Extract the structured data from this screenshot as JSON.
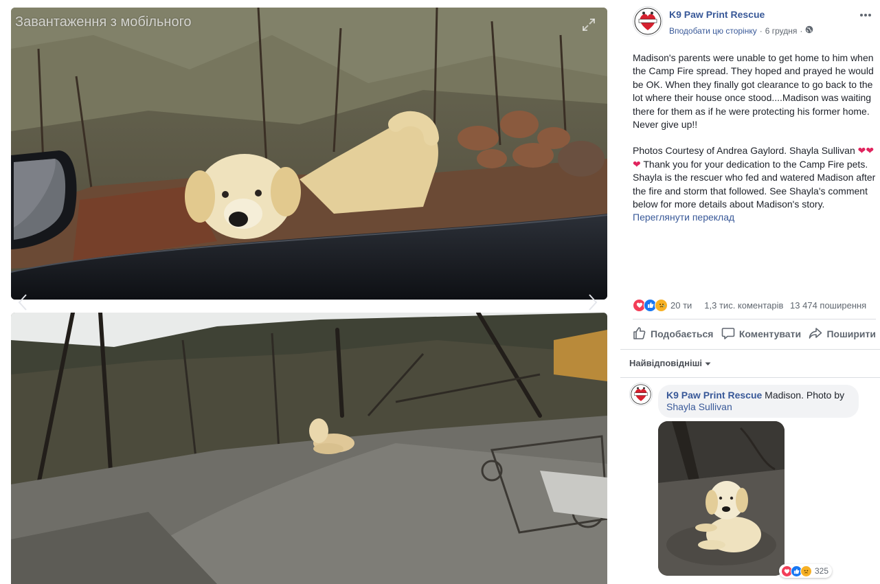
{
  "viewer": {
    "upload_caption": "Завантаження з мобільного"
  },
  "post": {
    "page_name": "K9 Paw Print Rescue",
    "like_page": "Вподобати цю сторінку",
    "separator": "·",
    "date": "6 грудня",
    "paragraph1": "Madison's parents were unable to get home to him when the Camp Fire spread. They hoped and prayed he would be OK. When they finally got clearance to go back to the lot where their house once stood....Madison was waiting there for them as if he were protecting his former home. Never give up!!",
    "paragraph2_start": "Photos Courtesy of Andrea Gaylord. Shayla Sullivan",
    "hearts": "❤❤❤",
    "paragraph2_end": " Thank you for your dedication to the Camp Fire pets. Shayla is the rescuer who fed and watered Madison after the fire and storm that followed. See Shayla's comment below for more details about Madison's story.",
    "see_translation": "Переглянути переклад"
  },
  "stats": {
    "reactions_count": "20 ти",
    "comments": "1,3 тис. коментарів",
    "shares": "13 474 поширення"
  },
  "actions": {
    "like": "Подобається",
    "comment": "Коментувати",
    "share": "Поширити"
  },
  "sort": {
    "label": "Найвідповідніші"
  },
  "comment": {
    "author": "K9 Paw Print Rescue",
    "text": " Madison. Photo by ",
    "tag": "Shayla Sullivan",
    "reactions_count": "325"
  },
  "icons": {
    "expand": "expand-icon",
    "more": "more-options-icon",
    "globe": "globe-icon",
    "like": "like-icon",
    "comment": "comment-icon",
    "share": "share-icon",
    "love_reaction": "love-reaction-icon",
    "like_reaction": "like-reaction-icon",
    "sad_reaction": "sad-reaction-icon"
  },
  "colors": {
    "link": "#385898",
    "secondary_text": "#606770",
    "love": "#f33e58",
    "like": "#1877f2",
    "sad": "#f7b125"
  }
}
